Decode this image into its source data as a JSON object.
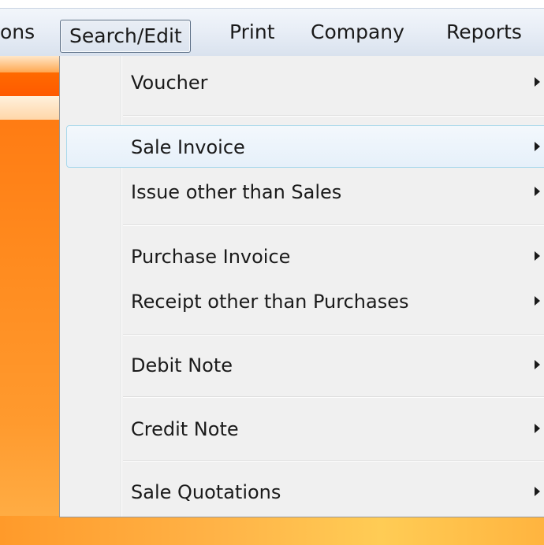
{
  "menubar": {
    "items": [
      {
        "label": "ons"
      },
      {
        "label": "Search/Edit"
      },
      {
        "label": "Print"
      },
      {
        "label": "Company"
      },
      {
        "label": "Reports"
      }
    ]
  },
  "dropdown": {
    "items": [
      {
        "label": "Voucher"
      },
      {
        "label": "Sale Invoice"
      },
      {
        "label": "Issue other than Sales"
      },
      {
        "label": "Purchase Invoice"
      },
      {
        "label": "Receipt other than Purchases"
      },
      {
        "label": "Debit Note"
      },
      {
        "label": "Credit Note"
      },
      {
        "label": "Sale Quotations"
      }
    ]
  },
  "colors": {
    "menubar": "#e6ecf5",
    "dropdown": "#f0f0f0",
    "highlight_border": "#a8d8eb",
    "app_background": "#ff7a12"
  }
}
